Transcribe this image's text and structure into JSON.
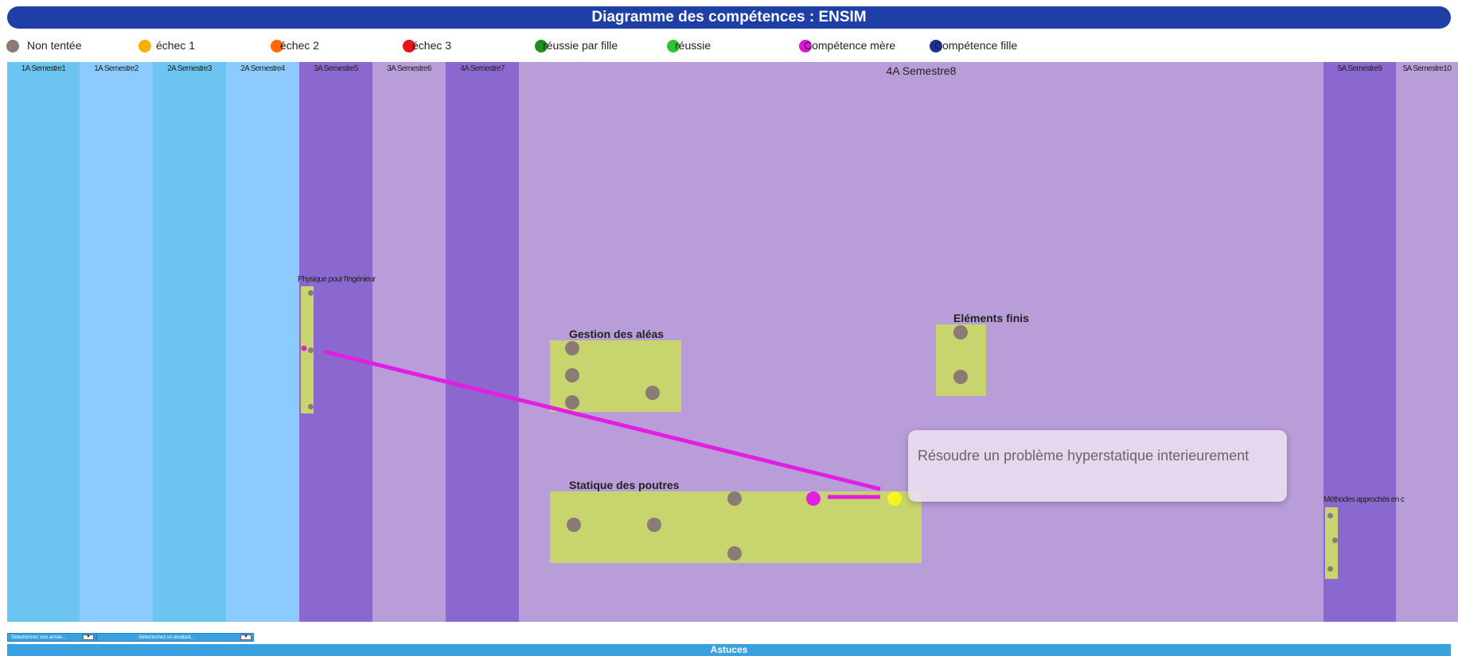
{
  "title": "Diagramme des compétences : ENSIM",
  "legend": [
    {
      "label": "Non tentée",
      "color": "#8a7b74"
    },
    {
      "label": "échec 1",
      "color": "#f7b000"
    },
    {
      "label": "échec 2",
      "color": "#ff6a00"
    },
    {
      "label": "échec 3",
      "color": "#e8131a"
    },
    {
      "label": "réussie par fille",
      "color": "#1e8f1e"
    },
    {
      "label": "réussie",
      "color": "#35c035"
    },
    {
      "label": "Compétence mère",
      "color": "#d41ad4"
    },
    {
      "label": "Compétence fille",
      "color": "#1d2f9a"
    }
  ],
  "semesters": [
    {
      "label": "1A Semestre1",
      "color": "#6cc4f0"
    },
    {
      "label": "1A Semestre2",
      "color": "#8ccbff"
    },
    {
      "label": "2A Semestre3",
      "color": "#6cc4f0"
    },
    {
      "label": "2A Semestre4",
      "color": "#8ccbff"
    },
    {
      "label": "3A Semestre5",
      "color": "#8a68cf"
    },
    {
      "label": "3A Semestre6",
      "color": "#b89dd8"
    },
    {
      "label": "4A Semestre7",
      "color": "#8a68cf"
    },
    {
      "label": "4A Semestre8",
      "color": "#b89dd8"
    },
    {
      "label": "5A Semestre9",
      "color": "#8a68cf"
    },
    {
      "label": "5A Semestre10",
      "color": "#b89dd8"
    }
  ],
  "skills": {
    "physique": "Physique pour l'Ingénieur",
    "aleas": "Gestion des aléas",
    "elements": "Eléments finis",
    "poutres": "Statique des poutres",
    "methodes": "Méthodes approchés en c"
  },
  "tooltip": "Résoudre un problème hyperstatique interieurement",
  "selects": {
    "year": "Sélectionnez une année...",
    "student": "Sélectionnez un étudiant..."
  },
  "astuces": "Astuces"
}
